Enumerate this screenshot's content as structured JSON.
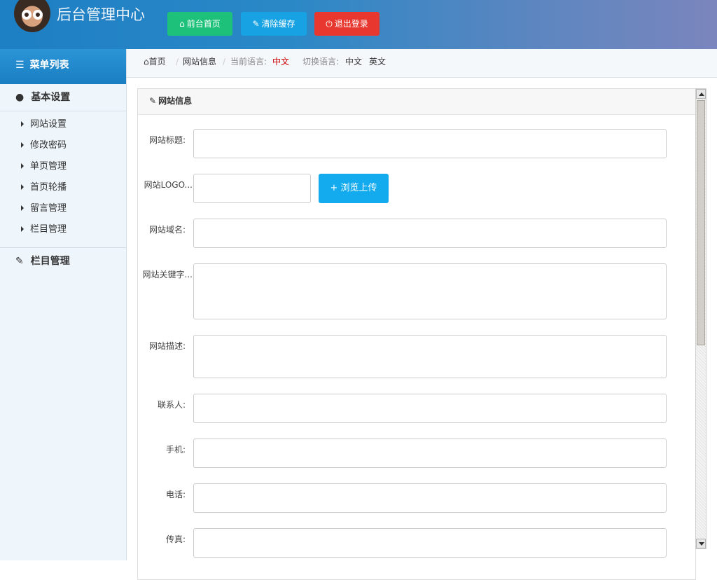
{
  "header": {
    "title": "后台管理中心",
    "buttons": {
      "home": "前台首页",
      "clear_cache": "清除缓存",
      "logout": "退出登录"
    }
  },
  "sidebar": {
    "menu_title": "菜单列表",
    "groups": [
      {
        "label": "基本设置",
        "items": [
          "网站设置",
          "修改密码",
          "单页管理",
          "首页轮播",
          "留言管理",
          "栏目管理"
        ]
      },
      {
        "label": "栏目管理"
      }
    ]
  },
  "breadcrumb": {
    "home": "首页",
    "current": "网站信息",
    "lang_label": "当前语言:",
    "lang_value": "中文",
    "switch_label": "切换语言:",
    "options": [
      "中文",
      "英文"
    ]
  },
  "panel": {
    "title": "网站信息",
    "upload_button": "+ 浏览上传",
    "fields": [
      {
        "label": "网站标题:"
      },
      {
        "label": "网站LOGO..."
      },
      {
        "label": "网站域名:"
      },
      {
        "label": "网站关键字..."
      },
      {
        "label": "网站描述:"
      },
      {
        "label": "联系人:"
      },
      {
        "label": "手机:"
      },
      {
        "label": "电话:"
      },
      {
        "label": "传真:"
      }
    ]
  },
  "icons": {
    "home": "home-icon",
    "wrench": "wrench-icon",
    "power": "power-icon",
    "list": "list-icon",
    "user": "user-icon",
    "edit": "edit-icon"
  },
  "colors": {
    "header_start": "#1d7fc4",
    "btn_home": "#1ec17a",
    "btn_cache": "#16a2e3",
    "btn_logout": "#e8372f",
    "upload": "#14aaee",
    "lang_active": "#cc0000"
  }
}
